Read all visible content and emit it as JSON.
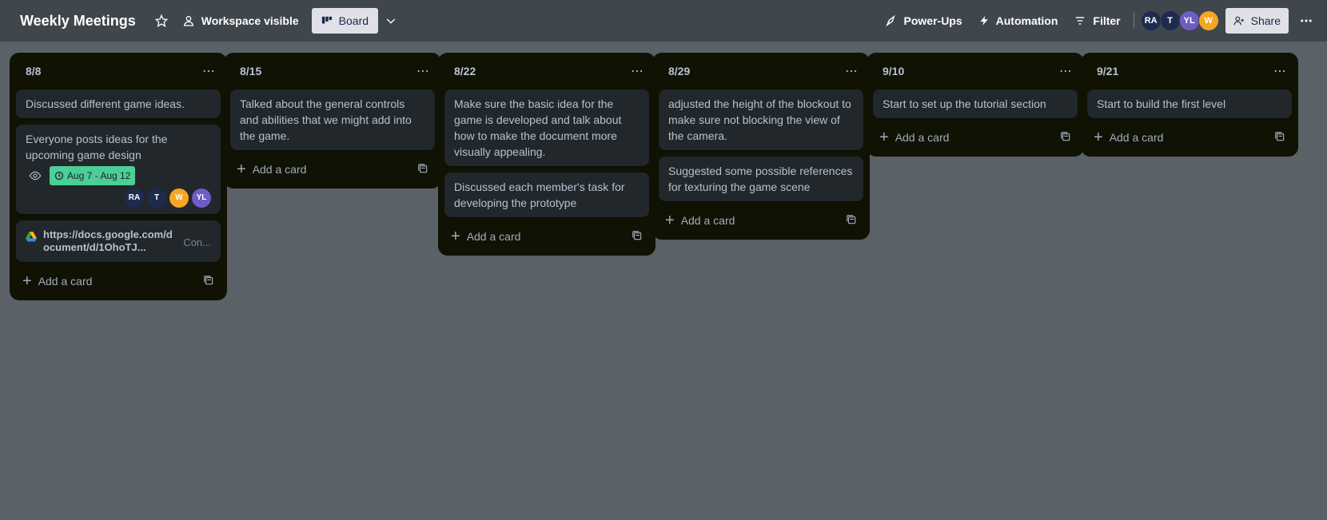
{
  "board": {
    "title": "Weekly Meetings",
    "visibility_label": "Workspace visible",
    "view_label": "Board"
  },
  "header_actions": {
    "powerups": "Power-Ups",
    "automation": "Automation",
    "filter": "Filter",
    "share": "Share"
  },
  "members": [
    {
      "initials": "RA",
      "color": "#1d2b4f"
    },
    {
      "initials": "T",
      "color": "#1d2b4f"
    },
    {
      "initials": "YL",
      "color": "#6e5dc6"
    },
    {
      "initials": "W",
      "color": "#f5a623"
    }
  ],
  "add_card_label": "Add a card",
  "lists": [
    {
      "title": "8/8",
      "cards": [
        {
          "text": "Discussed different game ideas."
        },
        {
          "text": "Everyone posts ideas for the upcoming game design",
          "date": "Aug 7 - Aug 12",
          "members": [
            "RA",
            "T",
            "W",
            "YL"
          ]
        },
        {
          "link": "https://docs.google.com/document/d/1OhoTJ...",
          "extra": "Con..."
        }
      ]
    },
    {
      "title": "8/15",
      "cards": [
        {
          "text": "Talked about the general controls and abilities that we might add into the game."
        }
      ]
    },
    {
      "title": "8/22",
      "cards": [
        {
          "text": "Make sure the basic idea for the game is developed and talk about how to make the document more visually appealing."
        },
        {
          "text": "Discussed each member's task for developing the prototype"
        }
      ]
    },
    {
      "title": "8/29",
      "cards": [
        {
          "text": "adjusted the height of the blockout to make sure not blocking the view of the camera."
        },
        {
          "text": "Suggested some possible references for texturing the game scene"
        }
      ]
    },
    {
      "title": "9/10",
      "cards": [
        {
          "text": "Start to set up the tutorial section"
        }
      ]
    },
    {
      "title": "9/21",
      "cards": [
        {
          "text": "Start to build the first level"
        }
      ]
    }
  ],
  "colors": {
    "topbar": "#3f464c",
    "background": "#5a6167",
    "list": "#101204",
    "card": "#22272b",
    "date_badge": "#4bce97"
  }
}
